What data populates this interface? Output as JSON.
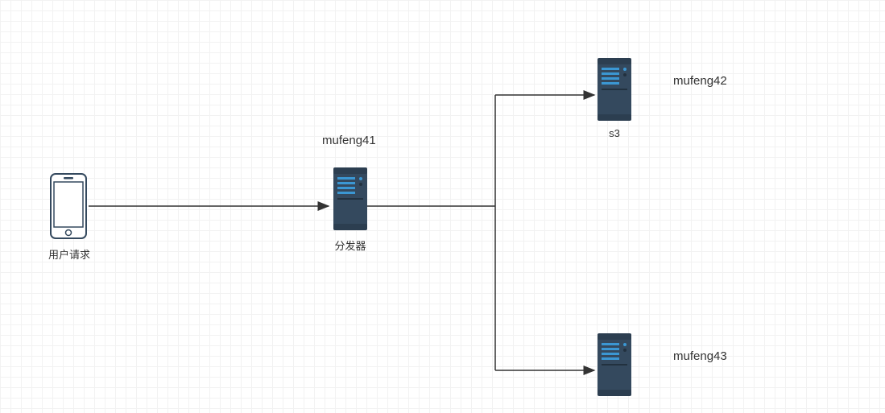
{
  "diagram": {
    "type": "network-topology",
    "nodes": {
      "client": {
        "icon": "smartphone",
        "caption": "用户请求"
      },
      "dispatcher": {
        "icon": "server",
        "title": "mufeng41",
        "caption": "分发器"
      },
      "server_a": {
        "icon": "server",
        "title": "mufeng42",
        "caption": "s3"
      },
      "server_b": {
        "icon": "server",
        "title": "mufeng43"
      }
    },
    "edges": [
      {
        "from": "client",
        "to": "dispatcher"
      },
      {
        "from": "dispatcher",
        "to": "server_a"
      },
      {
        "from": "dispatcher",
        "to": "server_b"
      }
    ],
    "colors": {
      "device_fill": "#34495e",
      "device_accent": "#3b97d3",
      "stroke": "#333333"
    }
  }
}
